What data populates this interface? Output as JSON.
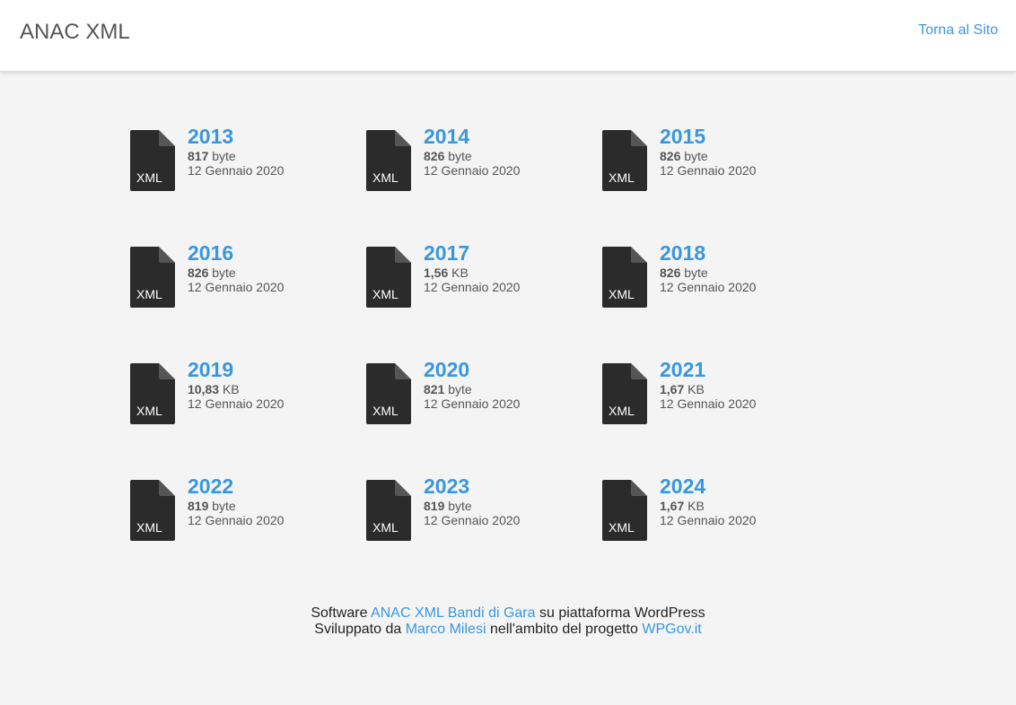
{
  "header": {
    "title": "ANAC XML",
    "back_link": "Torna al Sito"
  },
  "files": [
    {
      "year": "2013",
      "size_value": "817",
      "size_unit": "byte",
      "date": "12 Gennaio 2020",
      "icon": "xml-file-icon",
      "icon_label": "XML"
    },
    {
      "year": "2014",
      "size_value": "826",
      "size_unit": "byte",
      "date": "12 Gennaio 2020",
      "icon": "xml-file-icon",
      "icon_label": "XML"
    },
    {
      "year": "2015",
      "size_value": "826",
      "size_unit": "byte",
      "date": "12 Gennaio 2020",
      "icon": "xml-file-icon",
      "icon_label": "XML"
    },
    {
      "year": "2016",
      "size_value": "826",
      "size_unit": "byte",
      "date": "12 Gennaio 2020",
      "icon": "xml-file-icon",
      "icon_label": "XML"
    },
    {
      "year": "2017",
      "size_value": "1,56",
      "size_unit": "KB",
      "date": "12 Gennaio 2020",
      "icon": "xml-file-icon",
      "icon_label": "XML"
    },
    {
      "year": "2018",
      "size_value": "826",
      "size_unit": "byte",
      "date": "12 Gennaio 2020",
      "icon": "xml-file-icon",
      "icon_label": "XML"
    },
    {
      "year": "2019",
      "size_value": "10,83",
      "size_unit": "KB",
      "date": "12 Gennaio 2020",
      "icon": "xml-file-icon",
      "icon_label": "XML"
    },
    {
      "year": "2020",
      "size_value": "821",
      "size_unit": "byte",
      "date": "12 Gennaio 2020",
      "icon": "xml-file-icon",
      "icon_label": "XML"
    },
    {
      "year": "2021",
      "size_value": "1,67",
      "size_unit": "KB",
      "date": "12 Gennaio 2020",
      "icon": "xml-file-icon",
      "icon_label": "XML"
    },
    {
      "year": "2022",
      "size_value": "819",
      "size_unit": "byte",
      "date": "12 Gennaio 2020",
      "icon": "xml-file-icon",
      "icon_label": "XML"
    },
    {
      "year": "2023",
      "size_value": "819",
      "size_unit": "byte",
      "date": "12 Gennaio 2020",
      "icon": "xml-file-icon",
      "icon_label": "XML"
    },
    {
      "year": "2024",
      "size_value": "1,67",
      "size_unit": "KB",
      "date": "12 Gennaio 2020",
      "icon": "xml-file-icon",
      "icon_label": "XML"
    }
  ],
  "footer": {
    "line1_prefix": "Software",
    "line1_link": "ANAC XML Bandi di Gara",
    "line1_suffix": "su piattaforma WordPress",
    "line2_prefix": "Sviluppato da",
    "line2_link1": "Marco Milesi",
    "line2_middle": "nell'ambito del progetto",
    "line2_link2": "WPGov.it"
  },
  "colors": {
    "accent": "#3a97dd",
    "background": "#f4f4f4",
    "header_bg": "#ffffff",
    "icon_dark": "#2b2b2b",
    "text_gray": "#555555"
  }
}
